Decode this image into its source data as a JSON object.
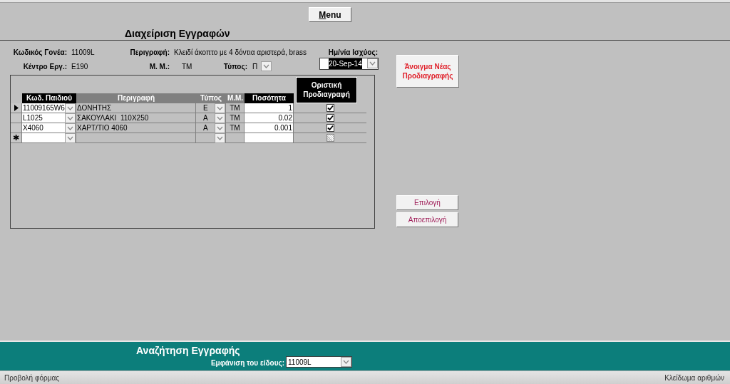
{
  "form": {
    "menu_button": "Menu",
    "title": "Διαχείριση Εγγραφών"
  },
  "header_fields": {
    "parent_code": {
      "label": "Κωδικός Γονέα:",
      "value": "11009L"
    },
    "description": {
      "label": "Περιγραφή:",
      "value": "Κλειδί άκοπτο με 4 δόντια αριστερά, brass"
    },
    "work_center": {
      "label": "Κέντρο Εργ.:",
      "value": "E190"
    },
    "unit": {
      "label": "Μ. Μ.:",
      "value": "ΤΜ"
    },
    "type": {
      "label": "Τύπος:",
      "value": "Π"
    },
    "valid_date": {
      "label": "Ημ/νία Ισχύος:",
      "value": "20-Sep-14",
      "text_selected": true
    }
  },
  "subform": {
    "columns": [
      {
        "label": "Κωδ. Παιδιού",
        "kind": "dark"
      },
      {
        "label": "Περιγραφή",
        "kind": "grey"
      },
      {
        "label": "Τύπος",
        "kind": "grey"
      },
      {
        "label": "Μ.Μ.",
        "kind": "grey"
      },
      {
        "label": "Ποσότητα",
        "kind": "dark"
      },
      {
        "label": "Οριστική Προδιαγραφή",
        "kind": "tall"
      }
    ],
    "rows": [
      {
        "code": "11009165W6",
        "description": "ΔΟΝΗΤΗΣ",
        "type": "Ε",
        "unit": "ΤΜ",
        "quantity": "1",
        "final": true,
        "selected": true
      },
      {
        "code": "L1025",
        "description": "ΣΑΚΟΥΛΑΚΙ  110Χ250",
        "type": "Α",
        "unit": "ΤΜ",
        "quantity": "0.02",
        "final": true,
        "selected": false
      },
      {
        "code": "X4060",
        "description": "ΧΑΡΤ/ΤΙΟ 4060",
        "type": "Α",
        "unit": "ΤΜ",
        "quantity": "0.001",
        "final": true,
        "selected": false
      }
    ],
    "new_row": {
      "marker": "✱",
      "checkbox_disabled": true
    }
  },
  "buttons": {
    "new_spec": "Άνοιγμα Νέας Προδιαγραφής",
    "select": "Επιλογή",
    "deselect": "Αποεπιλογή"
  },
  "search": {
    "title": "Αναζήτηση Εγγραφής",
    "label": "Εμφάνιση του είδους:",
    "value": "11009L"
  },
  "status_bar": {
    "left": "Προβολή φόρμας",
    "right": "Κλείδωμα αριθμών"
  }
}
